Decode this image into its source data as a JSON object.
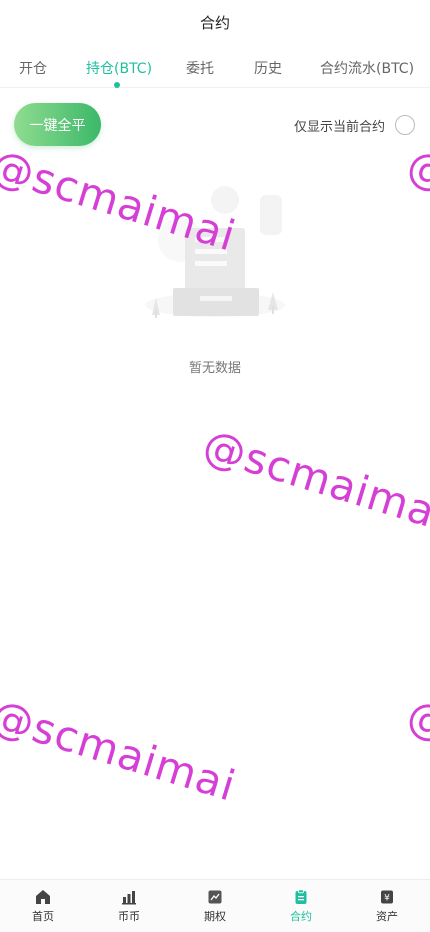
{
  "header": {
    "title": "合约"
  },
  "tabs": [
    {
      "label": "开仓"
    },
    {
      "label": "持仓(BTC)"
    },
    {
      "label": "委托"
    },
    {
      "label": "历史"
    },
    {
      "label": "合约流水(BTC)"
    }
  ],
  "active_tab": "持仓(BTC)",
  "actions": {
    "close_all_label": "一键全平",
    "filter_label": "仅显示当前合约",
    "filter_checked": false
  },
  "empty_state": {
    "text": "暂无数据"
  },
  "watermark": {
    "text": "@scmaimai",
    "color": "#d63fd6"
  },
  "bottom_nav": [
    {
      "label": "首页",
      "icon": "home-icon"
    },
    {
      "label": "币币",
      "icon": "bar-chart-icon"
    },
    {
      "label": "期权",
      "icon": "options-icon"
    },
    {
      "label": "合约",
      "icon": "contract-icon"
    },
    {
      "label": "资产",
      "icon": "assets-icon"
    }
  ],
  "active_nav": "合约",
  "colors": {
    "accent": "#1fbfa0",
    "button_start": "#8fdc8f",
    "button_end": "#3cb86a"
  }
}
